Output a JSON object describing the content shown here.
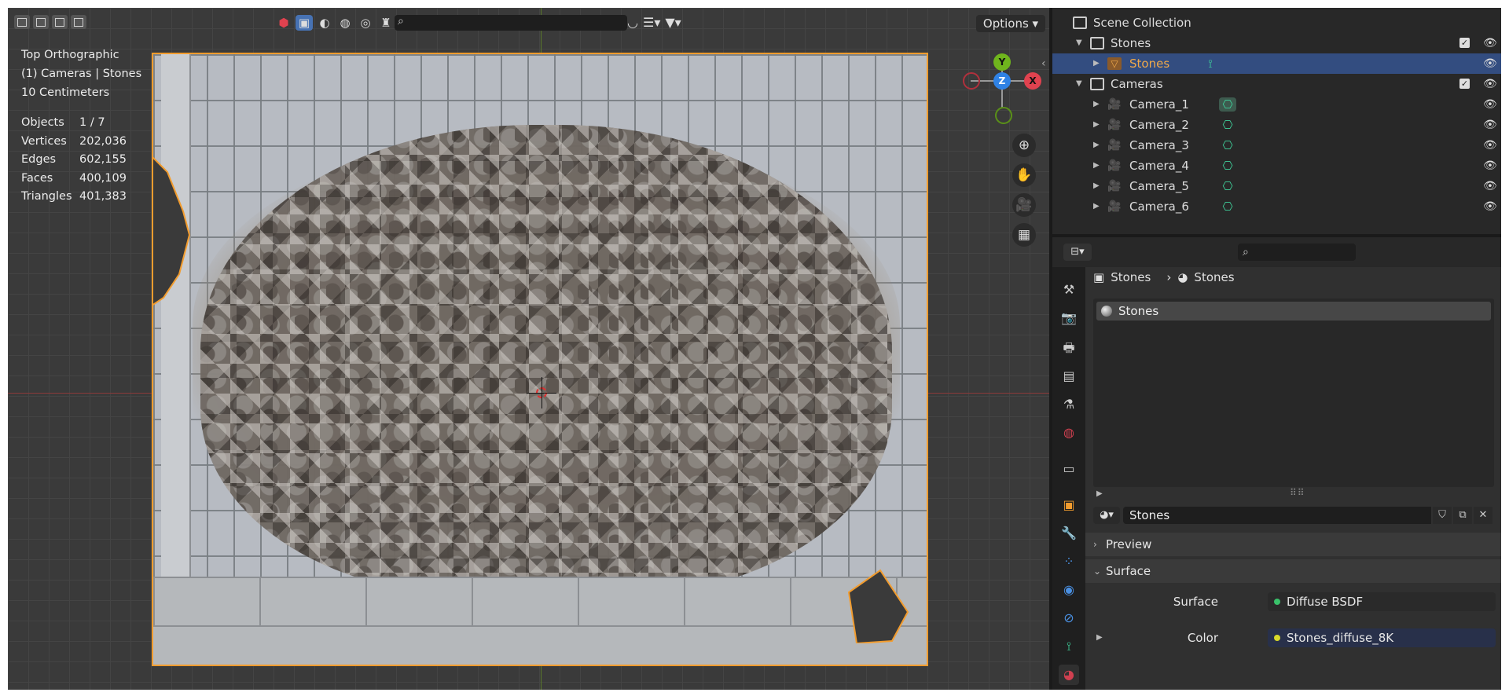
{
  "viewport": {
    "header": {
      "options_label": "Options",
      "search_icon": "magnifier-icon",
      "search_value": ""
    },
    "overlay": {
      "view_name": "Top Orthographic",
      "collection_line": "(1) Cameras | Stones",
      "scale_text": "10 Centimeters"
    },
    "stats": [
      {
        "key": "Objects",
        "value": "1 / 7"
      },
      {
        "key": "Vertices",
        "value": "202,036"
      },
      {
        "key": "Edges",
        "value": "602,155"
      },
      {
        "key": "Faces",
        "value": "400,109"
      },
      {
        "key": "Triangles",
        "value": "401,383"
      }
    ],
    "gizmo": {
      "y": "Y",
      "z": "Z",
      "x": "X"
    },
    "colors": {
      "accent": "#4772b3",
      "camera_border": "#f29c2e",
      "x_axis": "#e0424f",
      "y_axis": "#6fb51d",
      "z_axis": "#2f82e5"
    }
  },
  "outliner": {
    "rows": [
      {
        "label": "Scene Collection"
      },
      {
        "label": "Stones"
      },
      {
        "label": "Stones"
      },
      {
        "label": "Cameras"
      },
      {
        "label": "Camera_1"
      },
      {
        "label": "Camera_2"
      },
      {
        "label": "Camera_3"
      },
      {
        "label": "Camera_4"
      },
      {
        "label": "Camera_5"
      },
      {
        "label": "Camera_6"
      }
    ],
    "selected_color": "#334d80",
    "selected_text_color": "#f0a94a"
  },
  "properties": {
    "search_value": "",
    "breadcrumb": {
      "object": "Stones",
      "material": "Stones"
    },
    "slot_list": [
      "Stones"
    ],
    "material_name": "Stones",
    "panels": {
      "preview": "Preview",
      "surface": "Surface"
    },
    "surface_row": {
      "label": "Surface",
      "value": "Diffuse BSDF",
      "dot_color": "#39c16a"
    },
    "color_row": {
      "label": "Color",
      "value": "Stones_diffuse_8K",
      "dot_color": "#d8d82a"
    }
  }
}
